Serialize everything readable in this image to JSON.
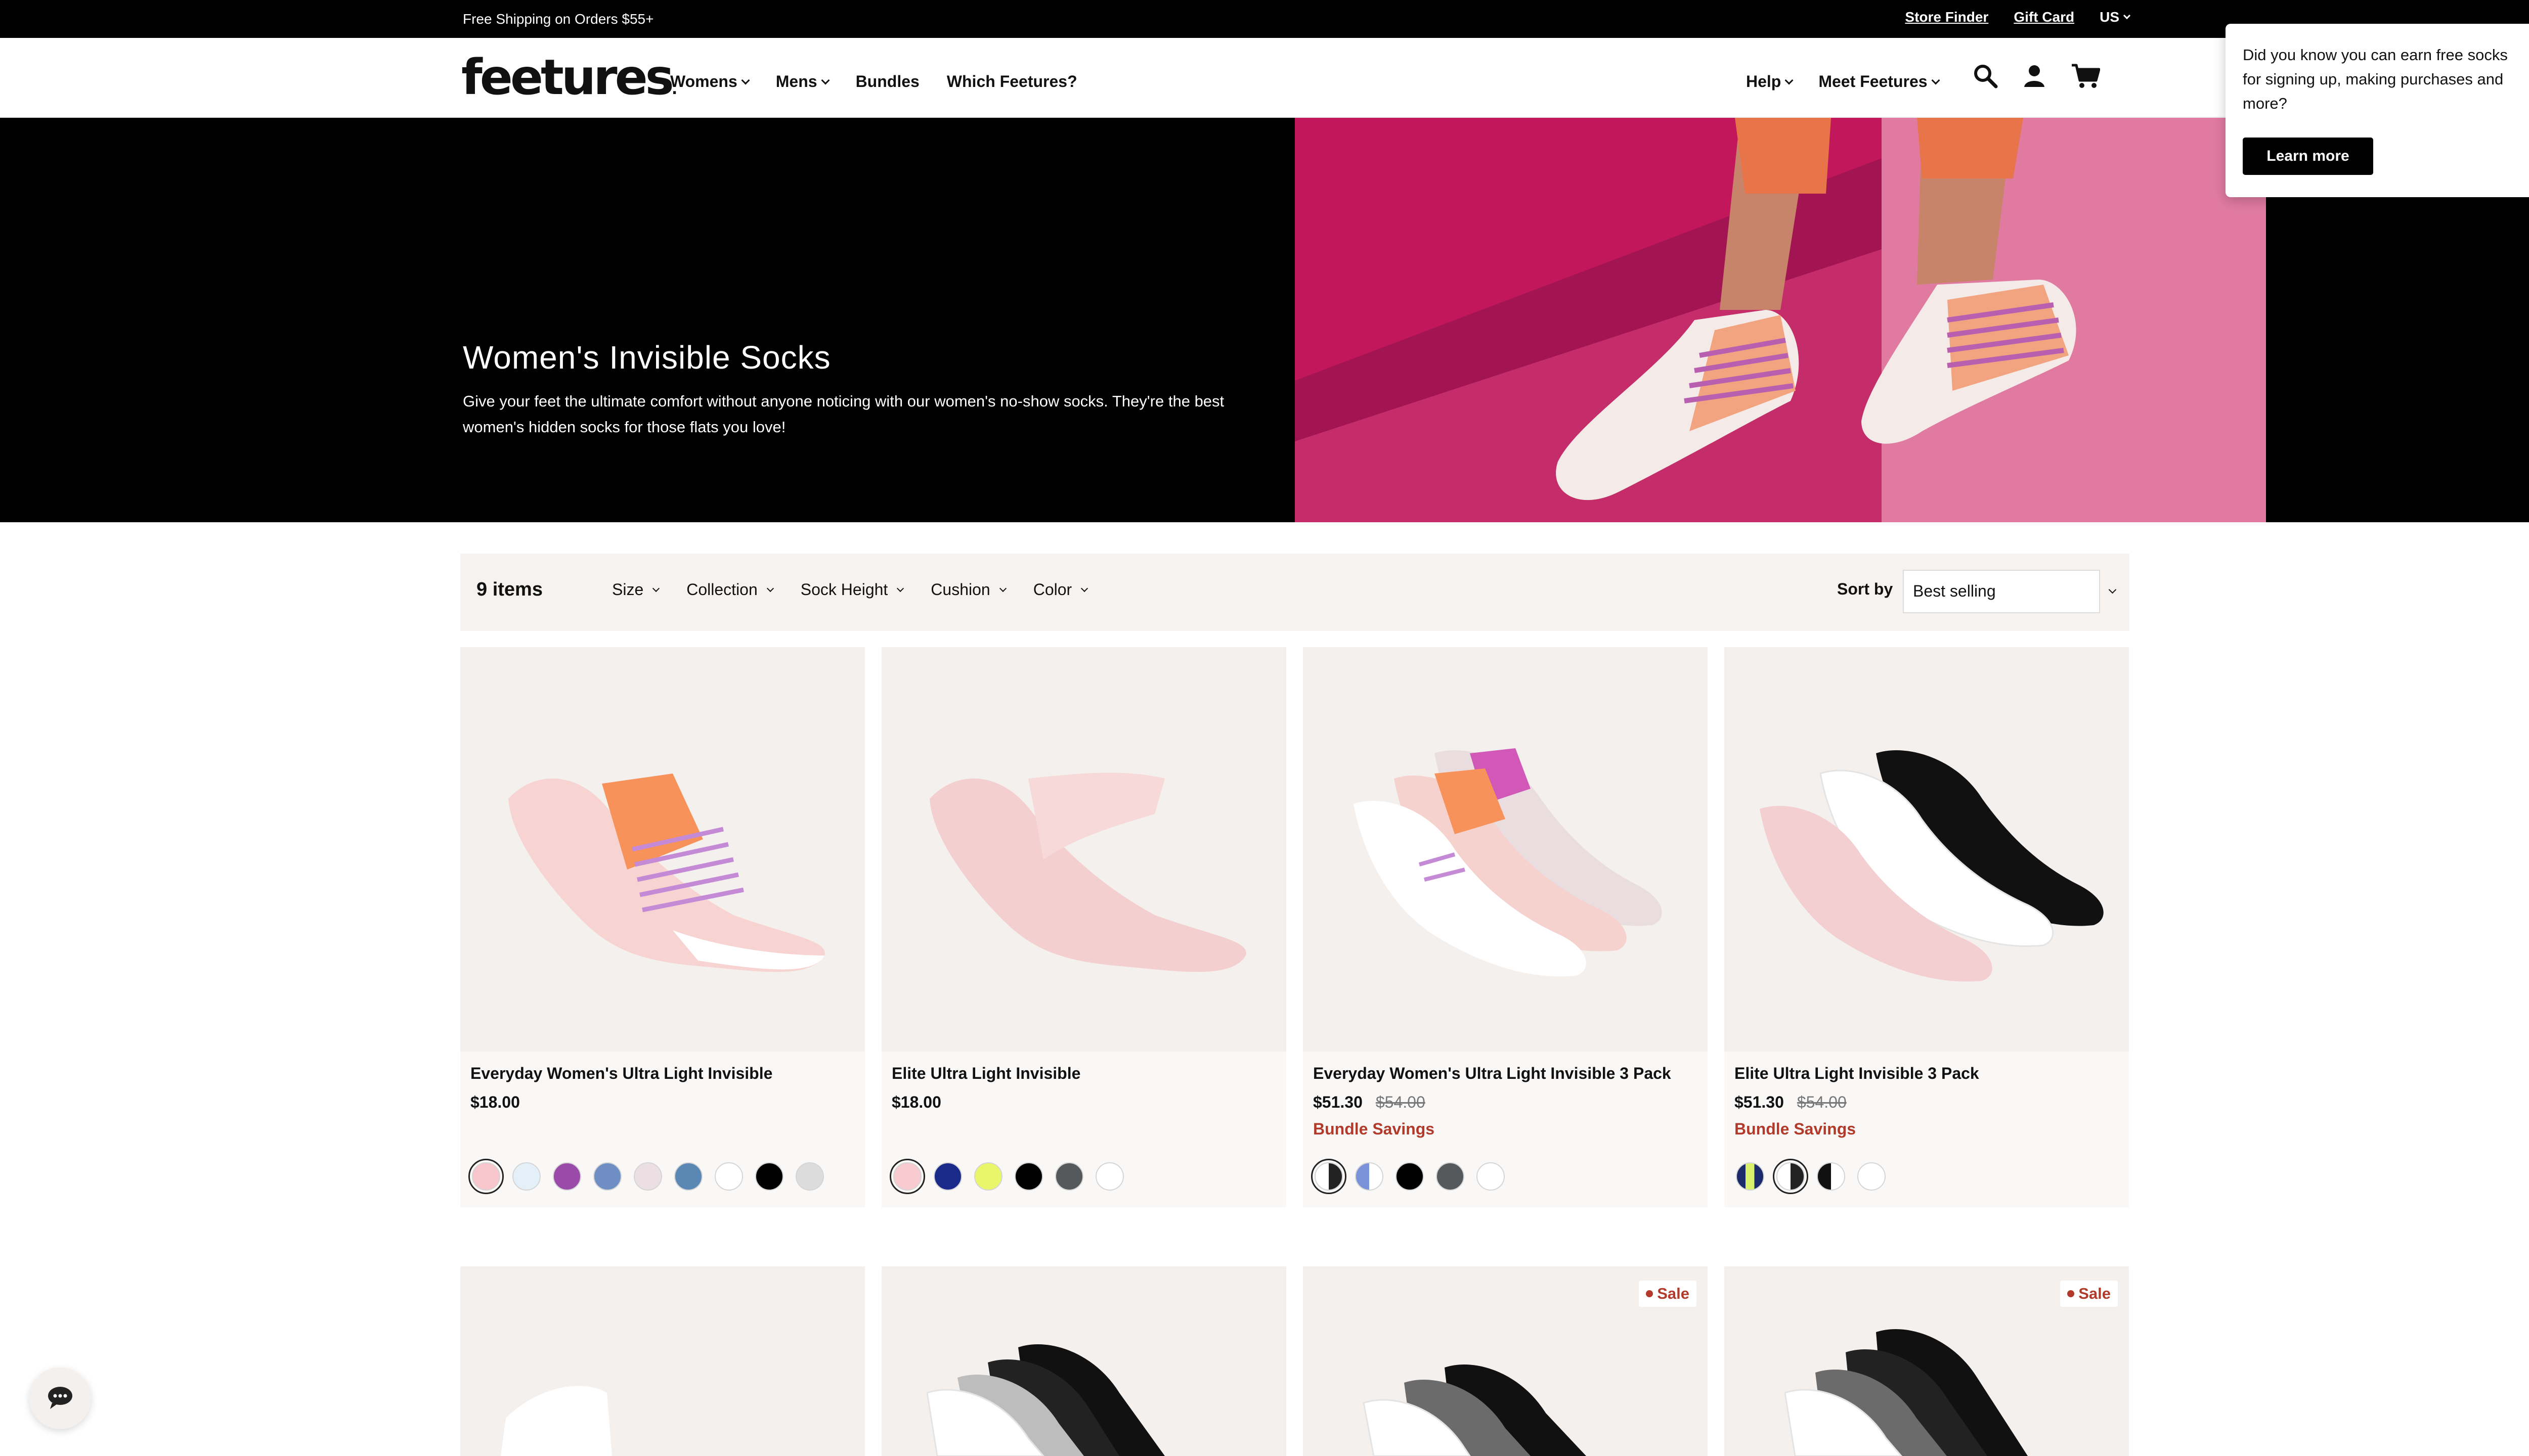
{
  "topbar": {
    "promo": "Free Shipping on Orders $55+",
    "store_finder": "Store Finder",
    "gift_card": "Gift Card",
    "country": "US"
  },
  "header": {
    "logo": "feetures",
    "nav_left": [
      "Womens",
      "Mens",
      "Bundles",
      "Which Feetures?"
    ],
    "nav_right": [
      "Help",
      "Meet Feetures"
    ]
  },
  "hero": {
    "title": "Women's Invisible Socks",
    "description": "Give your feet the ultimate comfort without anyone noticing with our women's no-show socks. They're the best women's hidden socks for those flats you love!"
  },
  "popup": {
    "message": "Did you know you can earn free socks for signing up, making purchases and more?",
    "button": "Learn more",
    "close": "×"
  },
  "filters": {
    "count": "9 items",
    "options": [
      "Size",
      "Collection",
      "Sock Height",
      "Cushion",
      "Color"
    ],
    "sort_label": "Sort by",
    "sort_value": "Best selling"
  },
  "products": [
    {
      "name": "Everyday Women's Ultra Light Invisible",
      "price": "$18.00",
      "compare": "",
      "badge": "",
      "swatches": [
        "#f6c6cc",
        "#e3f0f8",
        "#9a4aa8",
        "#6f8fc4",
        "#ecdfe3",
        "#5b87b5",
        "#ffffff",
        "#000000",
        "#dcdcdc"
      ]
    },
    {
      "name": "Elite Ultra Light Invisible",
      "price": "$18.00",
      "compare": "",
      "badge": "",
      "swatches": [
        "#f7cbd0",
        "#1a2a8a",
        "#e9f66a",
        "#000000",
        "#55595c",
        "#ffffff"
      ]
    },
    {
      "name": "Everyday Women's Ultra Light Invisible 3 Pack",
      "price": "$51.30",
      "compare": "$54.00",
      "badge": "Bundle Savings",
      "swatches": [
        "split-white-black",
        "split-blue-white",
        "#000000",
        "#55595c",
        "#ffffff"
      ]
    },
    {
      "name": "Elite Ultra Light Invisible 3 Pack",
      "price": "$51.30",
      "compare": "$54.00",
      "badge": "Bundle Savings",
      "swatches": [
        "split-navy-lime",
        "split-white-black",
        "split-black-white",
        "#ffffff"
      ]
    }
  ],
  "row2": {
    "sale_label": "Sale"
  },
  "colors": {
    "accent": "#b23a2a",
    "hero_pink": "#c2185b"
  }
}
